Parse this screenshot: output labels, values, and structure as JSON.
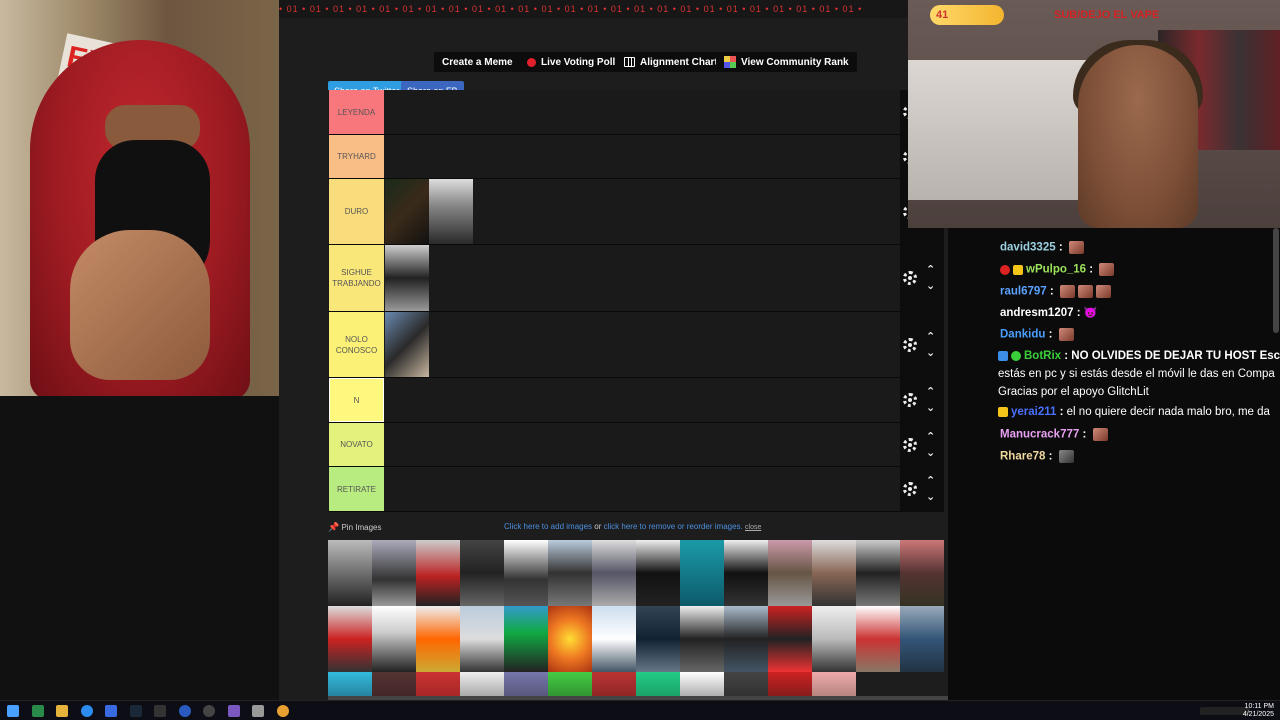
{
  "top_strip": {
    "text": "• 01 • 01 • 01 • 01 • 01 • 01 • 01 • 01 • 01 • 01 • 01 • 01 • 01 • 01 • 01 • 01 • 01 • 01 • 01 • 01 • 01 • 01 • 01 • 01 • 01 •"
  },
  "overlay": {
    "count": "41",
    "banner": "SUB/DEJO EL VAPE"
  },
  "nav": {
    "create_meme": "Create a Meme",
    "live_voting": "Live Voting Poll",
    "alignment_chart": "Alignment Chart",
    "community_rank": "View Community Rank"
  },
  "share": {
    "twitter": "Share on Twitter",
    "facebook": "Share on FB"
  },
  "tiers": [
    {
      "label": "LEYENDA",
      "color": "#f7777c"
    },
    {
      "label": "TRYHARD",
      "color": "#f9bd86"
    },
    {
      "label": "DURO",
      "color": "#f9dd7c"
    },
    {
      "label": "SIGHUE TRABJANDO",
      "color": "#fae779"
    },
    {
      "label": "NOLO CONOSCO",
      "color": "#fbf177"
    },
    {
      "label": "N",
      "color": "#fef97e"
    },
    {
      "label": "NOVATO",
      "color": "#e5f17d"
    },
    {
      "label": "RETIRATE",
      "color": "#b9ec80"
    }
  ],
  "pin_bar": {
    "pin_label": "Pin Images",
    "add_link": "Click here to add images",
    "or": " or ",
    "remove_link": "click here to remove or reorder images.",
    "close": "close"
  },
  "chat": [
    {
      "user": "david3325",
      "color": "#9ad0e0",
      "text": ""
    },
    {
      "user": "wPulpo_16",
      "color": "#9be35a",
      "text": ""
    },
    {
      "user": "raul6797",
      "color": "#5aa2ff",
      "text": ""
    },
    {
      "user": "andresm1207",
      "color": "#ffffff",
      "text": ""
    },
    {
      "user": "Dankidu",
      "color": "#4aa0ff",
      "text": ""
    },
    {
      "user": "BotRix",
      "color": "#3ad03a",
      "text": "NO OLVIDES DE DEJAR TU HOST Escribe"
    },
    {
      "user": "",
      "color": "#ffffff",
      "text": "estás en pc y si estás desde el móvil le das en Compa"
    },
    {
      "user": "",
      "color": "#ffffff",
      "text": "Gracias por el apoyo GlitchLit"
    },
    {
      "user": "yerai211",
      "color": "#4a70ff",
      "text": "el no quiere decir nada malo bro, me da"
    },
    {
      "user": "Manucrack777",
      "color": "#e8a0f0",
      "text": ""
    },
    {
      "user": "Rhare78",
      "color": "#f0d9a0",
      "text": ""
    }
  ],
  "taskbar": {
    "time": "10:11 PM",
    "date": "4/21/2025"
  }
}
